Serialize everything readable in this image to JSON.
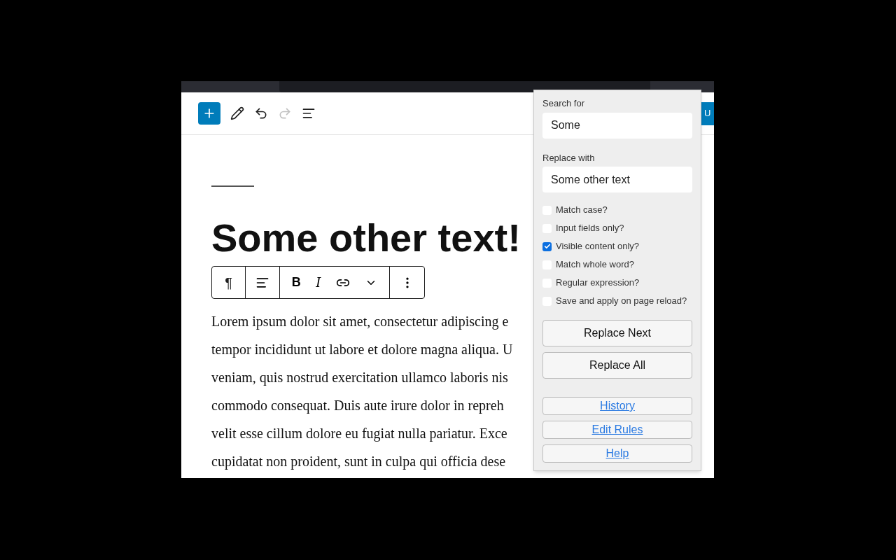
{
  "editor_toolbar": {
    "update_button": "U"
  },
  "heading": "Some other text!",
  "block_toolbar": {
    "paragraph": "¶",
    "bold": "B",
    "italic": "I"
  },
  "paragraph_lines": [
    "Lorem ipsum dolor sit amet, consectetur adipiscing e",
    "tempor incididunt ut labore et dolore magna aliqua. U",
    "veniam, quis nostrud exercitation ullamco laboris nis",
    "commodo consequat. Duis aute irure dolor in repreh",
    "velit esse cillum dolore eu fugiat nulla pariatur. Exce",
    "cupidatat non proident, sunt in culpa qui officia dese"
  ],
  "popup": {
    "search_label": "Search for",
    "search_value": "Some",
    "replace_label": "Replace with",
    "replace_value": "Some other text",
    "options": [
      {
        "label": "Match case?",
        "checked": false
      },
      {
        "label": "Input fields only?",
        "checked": false
      },
      {
        "label": "Visible content only?",
        "checked": true
      },
      {
        "label": "Match whole word?",
        "checked": false
      },
      {
        "label": "Regular expression?",
        "checked": false
      },
      {
        "label": "Save and apply on page reload?",
        "checked": false
      }
    ],
    "buttons": [
      "Replace Next",
      "Replace All"
    ],
    "links": [
      "History",
      "Edit Rules",
      "Help"
    ]
  }
}
